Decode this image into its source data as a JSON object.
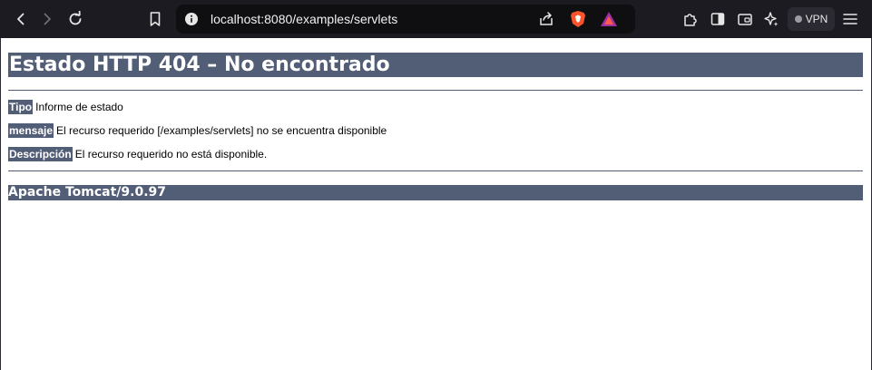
{
  "browser": {
    "url": "localhost:8080/examples/servlets",
    "vpn_label": "VPN",
    "icons": [
      "back-icon",
      "forward-icon",
      "reload-icon",
      "bookmark-icon",
      "site-info-icon",
      "share-icon",
      "brave-shields-icon",
      "brave-rewards-icon",
      "extensions-icon",
      "sidebar-icon",
      "wallet-icon",
      "leo-ai-icon",
      "menu-icon"
    ]
  },
  "page": {
    "title": "Estado HTTP 404 – No encontrado",
    "rows": [
      {
        "label": "Tipo",
        "value": "Informe de estado"
      },
      {
        "label": "mensaje",
        "value": "El recurso requerido [/examples/servlets] no se encuentra disponible"
      },
      {
        "label": "Descripción",
        "value": "El recurso requerido no está disponible."
      }
    ],
    "footer": "Apache Tomcat/9.0.97"
  },
  "colors": {
    "header_bg": "#525d76",
    "toolbar_bg": "#1c1b22",
    "brave_orange": "#fb542b"
  }
}
